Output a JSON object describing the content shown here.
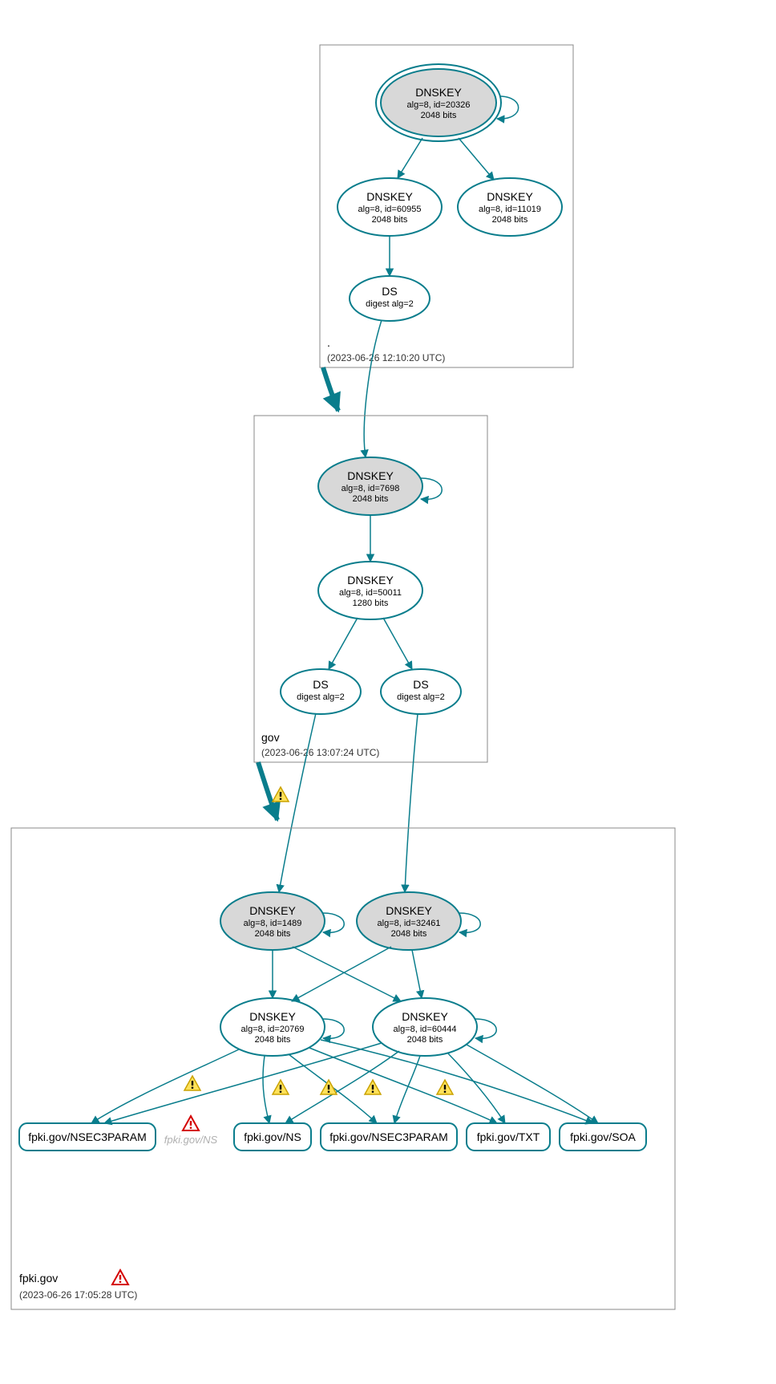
{
  "zones": {
    "root": {
      "label": ".",
      "timestamp": "(2023-06-26 12:10:20 UTC)"
    },
    "gov": {
      "label": "gov",
      "timestamp": "(2023-06-26 13:07:24 UTC)"
    },
    "fpki": {
      "label": "fpki.gov",
      "timestamp": "(2023-06-26 17:05:28 UTC)"
    }
  },
  "nodes": {
    "root_ksk": {
      "title": "DNSKEY",
      "sub1": "alg=8, id=20326",
      "sub2": "2048 bits"
    },
    "root_zsk1": {
      "title": "DNSKEY",
      "sub1": "alg=8, id=60955",
      "sub2": "2048 bits"
    },
    "root_zsk2": {
      "title": "DNSKEY",
      "sub1": "alg=8, id=11019",
      "sub2": "2048 bits"
    },
    "root_ds": {
      "title": "DS",
      "sub1": "digest alg=2",
      "sub2": ""
    },
    "gov_ksk": {
      "title": "DNSKEY",
      "sub1": "alg=8, id=7698",
      "sub2": "2048 bits"
    },
    "gov_zsk": {
      "title": "DNSKEY",
      "sub1": "alg=8, id=50011",
      "sub2": "1280 bits"
    },
    "gov_ds1": {
      "title": "DS",
      "sub1": "digest alg=2",
      "sub2": ""
    },
    "gov_ds2": {
      "title": "DS",
      "sub1": "digest alg=2",
      "sub2": ""
    },
    "fpki_ksk1": {
      "title": "DNSKEY",
      "sub1": "alg=8, id=1489",
      "sub2": "2048 bits"
    },
    "fpki_ksk2": {
      "title": "DNSKEY",
      "sub1": "alg=8, id=32461",
      "sub2": "2048 bits"
    },
    "fpki_zsk1": {
      "title": "DNSKEY",
      "sub1": "alg=8, id=20769",
      "sub2": "2048 bits"
    },
    "fpki_zsk2": {
      "title": "DNSKEY",
      "sub1": "alg=8, id=60444",
      "sub2": "2048 bits"
    }
  },
  "leaves": {
    "nsec3p_a": "fpki.gov/NSEC3PARAM",
    "ns_dim": "fpki.gov/NS",
    "ns": "fpki.gov/NS",
    "nsec3p_b": "fpki.gov/NSEC3PARAM",
    "txt": "fpki.gov/TXT",
    "soa": "fpki.gov/SOA"
  }
}
